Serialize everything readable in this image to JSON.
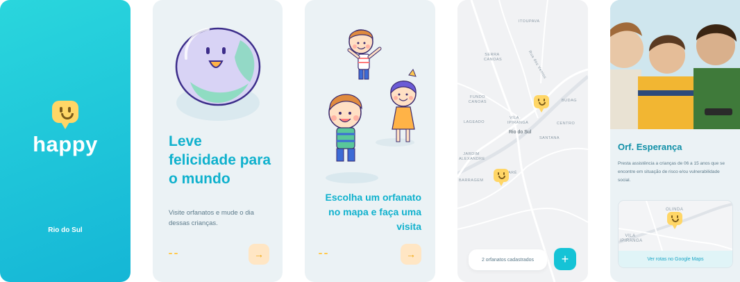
{
  "splash": {
    "brand": "happy",
    "city": "Rio do Sul",
    "background_color": "#15b6d6",
    "icon": "happy-face-logo-icon"
  },
  "onboarding_1": {
    "title": "Leve felicidade para o mundo",
    "description": "Visite orfanatos e mude o dia dessas crianças.",
    "next_icon": "arrow-right-icon",
    "illustration": "earth-globe-smiling"
  },
  "onboarding_2": {
    "title": "Escolha um orfanato no mapa e faça uma visita",
    "next_icon": "arrow-right-icon",
    "illustration": "happy-children"
  },
  "map": {
    "city_label": "Rio do Sul",
    "labels": [
      "ITOUPAVA",
      "SERRA CANOAS",
      "FUNDO CANOAS",
      "VILA IPIRANGA",
      "CENTRO",
      "BUDAG",
      "SANTANA",
      "LAGEADO",
      "MARÊ",
      "JARDIM ALEXANDRE",
      "BARRAGEM",
      "Rua dos Ventos"
    ],
    "orphanage_count_text": "2 orfanatos cadastrados",
    "add_label": "+"
  },
  "detail": {
    "name": "Orf. Esperança",
    "description": "Presta assistência a crianças de 06 a 15 anos que se encontre em situação de risco e/ou vulnerabilidade social.",
    "map_labels": [
      "OLINDA",
      "VILA IPIRANGA"
    ],
    "routes_link": "Ver rotas no Google Maps"
  }
}
